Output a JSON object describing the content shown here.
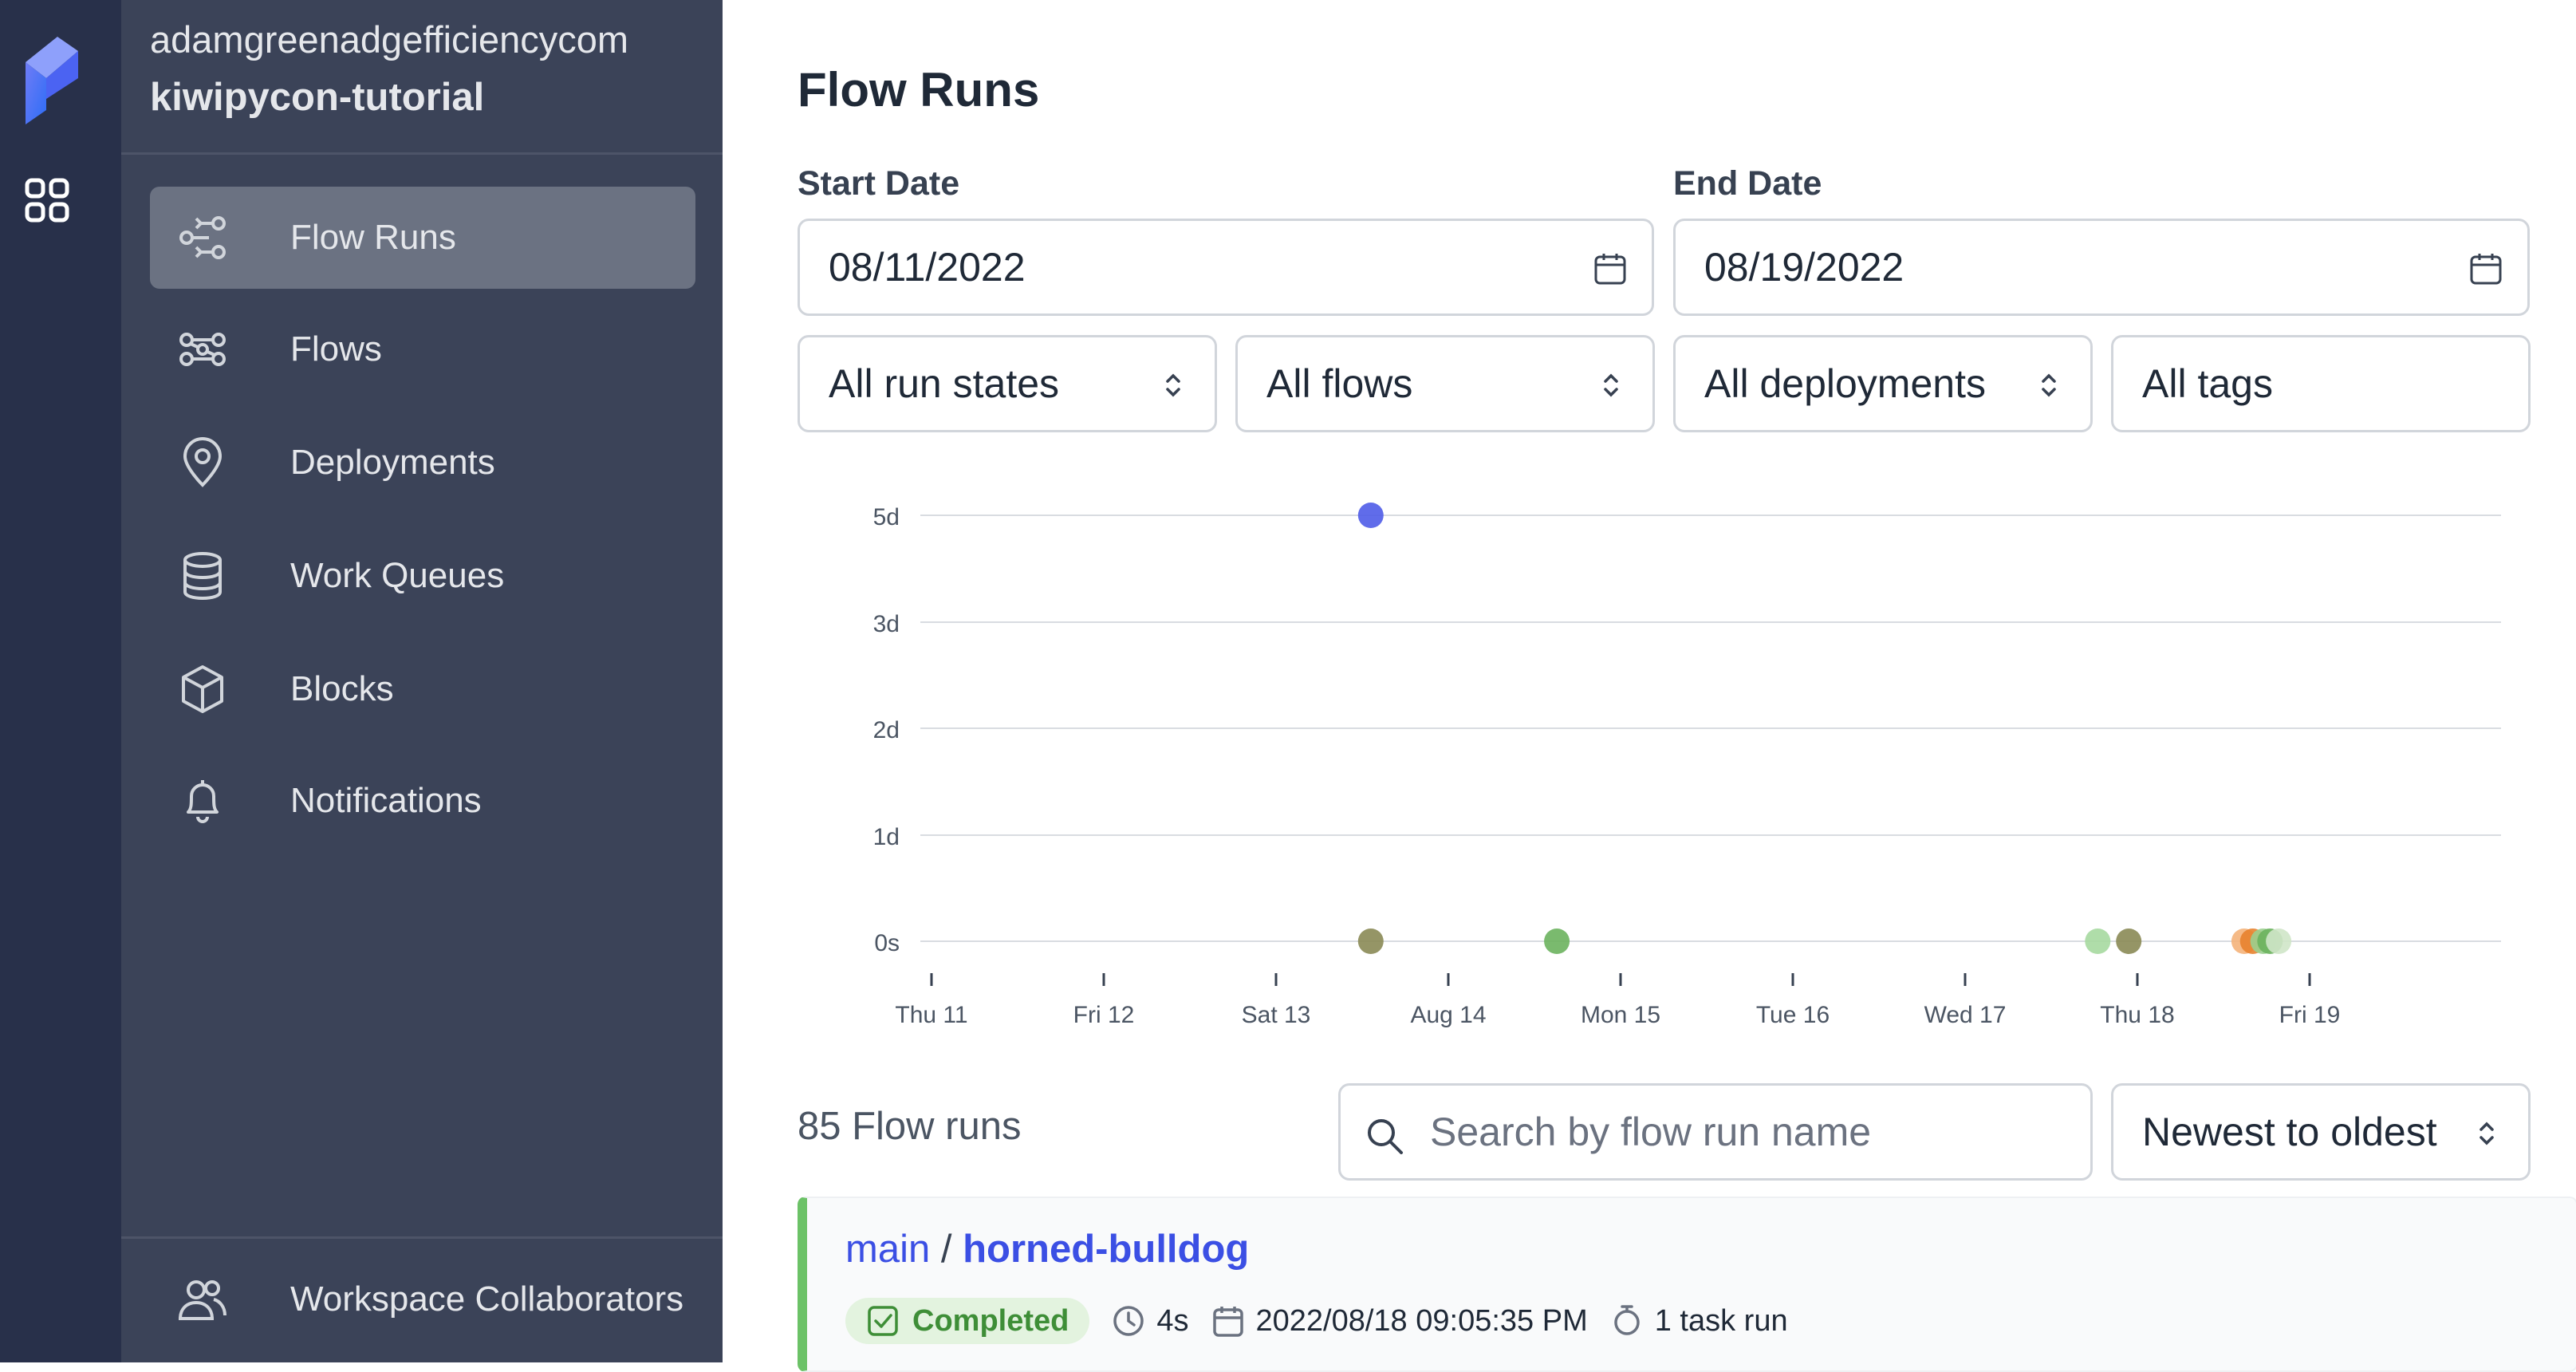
{
  "workspace": {
    "account": "adamgreenadgefficiencycom",
    "name": "kiwipycon-tutorial"
  },
  "sidebar": {
    "items": [
      {
        "label": "Flow Runs",
        "icon": "flow-runs-icon",
        "active": true
      },
      {
        "label": "Flows",
        "icon": "flows-icon",
        "active": false
      },
      {
        "label": "Deployments",
        "icon": "map-pin-icon",
        "active": false
      },
      {
        "label": "Work Queues",
        "icon": "database-icon",
        "active": false
      },
      {
        "label": "Blocks",
        "icon": "cube-icon",
        "active": false
      },
      {
        "label": "Notifications",
        "icon": "bell-icon",
        "active": false
      }
    ],
    "footer": {
      "label": "Workspace Collaborators",
      "icon": "users-icon"
    }
  },
  "page": {
    "title": "Flow Runs"
  },
  "filters": {
    "start_label": "Start Date",
    "start_value": "08/11/2022",
    "end_label": "End Date",
    "end_value": "08/19/2022",
    "states": "All run states",
    "flows": "All flows",
    "deployments": "All deployments",
    "tags": "All tags"
  },
  "chart_data": {
    "type": "scatter",
    "xlabel": "",
    "ylabel": "",
    "x_ticks": [
      "Thu 11",
      "Fri 12",
      "Sat 13",
      "Aug 14",
      "Mon 15",
      "Tue 16",
      "Wed 17",
      "Thu 18",
      "Fri 19"
    ],
    "y_ticks": [
      "0s",
      "1d",
      "2d",
      "3d",
      "5d"
    ],
    "x_unit": "days since Thu 11",
    "points": [
      {
        "x": 2.55,
        "y": "5d",
        "color": "#4f5ce8"
      },
      {
        "x": 2.55,
        "y": "0s",
        "color": "#8a8a55"
      },
      {
        "x": 3.63,
        "y": "0s",
        "color": "#6cb35e"
      },
      {
        "x": 6.77,
        "y": "0s",
        "color": "#a6d9a0"
      },
      {
        "x": 6.95,
        "y": "0s",
        "color": "#8a8a55"
      },
      {
        "x": 7.62,
        "y": "0s",
        "color": "#f4b27a"
      },
      {
        "x": 7.67,
        "y": "0s",
        "color": "#e8822e"
      },
      {
        "x": 7.73,
        "y": "0s",
        "color": "#9bcf8f"
      },
      {
        "x": 7.77,
        "y": "0s",
        "color": "#6cb35e"
      },
      {
        "x": 7.82,
        "y": "0s",
        "color": "#cfe6c8"
      }
    ]
  },
  "results": {
    "count": "85 Flow runs",
    "search_placeholder": "Search by flow run name",
    "sort": "Newest to oldest"
  },
  "runs": [
    {
      "flow": "main",
      "separator": "/",
      "name": "horned-bulldog",
      "state": "Completed",
      "duration": "4s",
      "start": "2022/08/18 09:05:35 PM",
      "tasks": "1 task run"
    }
  ]
}
